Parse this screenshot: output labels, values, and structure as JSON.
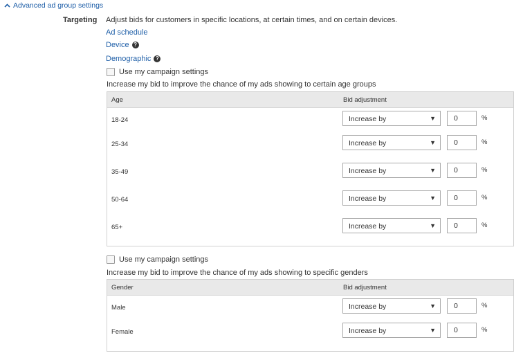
{
  "section": {
    "toggle_label": "Advanced ad group settings"
  },
  "targeting": {
    "label": "Targeting",
    "description": "Adjust bids for customers in specific locations, at certain times, and on certain devices.",
    "links": {
      "ad_schedule": "Ad schedule",
      "device": "Device",
      "demographic": "Demographic"
    },
    "help_glyph": "?"
  },
  "age": {
    "use_campaign_label": "Use my campaign settings",
    "description": "Increase my bid to improve the chance of my ads showing to certain age groups",
    "col_group": "Age",
    "col_bid": "Bid adjustment",
    "rows": [
      {
        "label": "18-24",
        "mode": "Increase by",
        "value": "0",
        "unit": "%"
      },
      {
        "label": "25-34",
        "mode": "Increase by",
        "value": "0",
        "unit": "%"
      },
      {
        "label": "35-49",
        "mode": "Increase by",
        "value": "0",
        "unit": "%"
      },
      {
        "label": "50-64",
        "mode": "Increase by",
        "value": "0",
        "unit": "%"
      },
      {
        "label": "65+",
        "mode": "Increase by",
        "value": "0",
        "unit": "%"
      }
    ]
  },
  "gender": {
    "use_campaign_label": "Use my campaign settings",
    "description": "Increase my bid to improve the chance of my ads showing to specific genders",
    "col_group": "Gender",
    "col_bid": "Bid adjustment",
    "rows": [
      {
        "label": "Male",
        "mode": "Increase by",
        "value": "0",
        "unit": "%"
      },
      {
        "label": "Female",
        "mode": "Increase by",
        "value": "0",
        "unit": "%"
      }
    ]
  },
  "colors": {
    "link": "#1f5fa8",
    "header_bg": "#e9e9e9",
    "border": "#cfcfcf"
  },
  "icons": {
    "toggle": "chevron-up-icon",
    "help": "help-icon",
    "dropdown": "dropdown-arrow-icon"
  }
}
